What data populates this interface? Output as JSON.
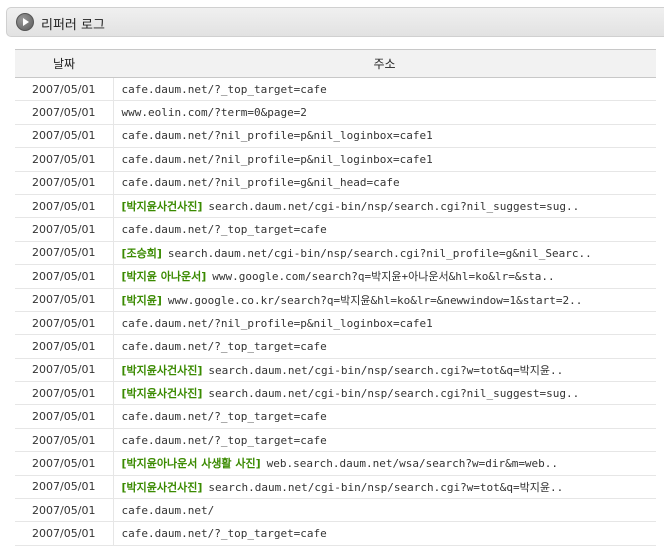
{
  "header": {
    "title": "리퍼러 로그"
  },
  "columns": {
    "date": "날짜",
    "address": "주소"
  },
  "colors": {
    "keyword": "#3a8a00"
  },
  "rows": [
    {
      "date": "2007/05/01",
      "keyword": "",
      "url": "cafe.daum.net/?_top_target=cafe"
    },
    {
      "date": "2007/05/01",
      "keyword": "",
      "url": "www.eolin.com/?term=0&page=2"
    },
    {
      "date": "2007/05/01",
      "keyword": "",
      "url": "cafe.daum.net/?nil_profile=p&nil_loginbox=cafe1"
    },
    {
      "date": "2007/05/01",
      "keyword": "",
      "url": "cafe.daum.net/?nil_profile=p&nil_loginbox=cafe1"
    },
    {
      "date": "2007/05/01",
      "keyword": "",
      "url": "cafe.daum.net/?nil_profile=g&nil_head=cafe"
    },
    {
      "date": "2007/05/01",
      "keyword": "[박지윤사건사진]",
      "url": "search.daum.net/cgi-bin/nsp/search.cgi?nil_suggest=sug.."
    },
    {
      "date": "2007/05/01",
      "keyword": "",
      "url": "cafe.daum.net/?_top_target=cafe"
    },
    {
      "date": "2007/05/01",
      "keyword": "[조승희]",
      "url": "search.daum.net/cgi-bin/nsp/search.cgi?nil_profile=g&nil_Searc.."
    },
    {
      "date": "2007/05/01",
      "keyword": "[박지윤 아나운서]",
      "url": "www.google.com/search?q=박지윤+아나운서&hl=ko&lr=&sta.."
    },
    {
      "date": "2007/05/01",
      "keyword": "[박지윤]",
      "url": "www.google.co.kr/search?q=박지윤&hl=ko&lr=&newwindow=1&start=2.."
    },
    {
      "date": "2007/05/01",
      "keyword": "",
      "url": "cafe.daum.net/?nil_profile=p&nil_loginbox=cafe1"
    },
    {
      "date": "2007/05/01",
      "keyword": "",
      "url": "cafe.daum.net/?_top_target=cafe"
    },
    {
      "date": "2007/05/01",
      "keyword": "[박지윤사건사진]",
      "url": "search.daum.net/cgi-bin/nsp/search.cgi?w=tot&q=박지윤.."
    },
    {
      "date": "2007/05/01",
      "keyword": "[박지윤사건사진]",
      "url": "search.daum.net/cgi-bin/nsp/search.cgi?nil_suggest=sug.."
    },
    {
      "date": "2007/05/01",
      "keyword": "",
      "url": "cafe.daum.net/?_top_target=cafe"
    },
    {
      "date": "2007/05/01",
      "keyword": "",
      "url": "cafe.daum.net/?_top_target=cafe"
    },
    {
      "date": "2007/05/01",
      "keyword": "[박지윤아나운서 사생활 사진]",
      "url": "web.search.daum.net/wsa/search?w=dir&m=web.."
    },
    {
      "date": "2007/05/01",
      "keyword": "[박지윤사건사진]",
      "url": "search.daum.net/cgi-bin/nsp/search.cgi?w=tot&q=박지윤.."
    },
    {
      "date": "2007/05/01",
      "keyword": "",
      "url": "cafe.daum.net/"
    },
    {
      "date": "2007/05/01",
      "keyword": "",
      "url": "cafe.daum.net/?_top_target=cafe"
    }
  ]
}
